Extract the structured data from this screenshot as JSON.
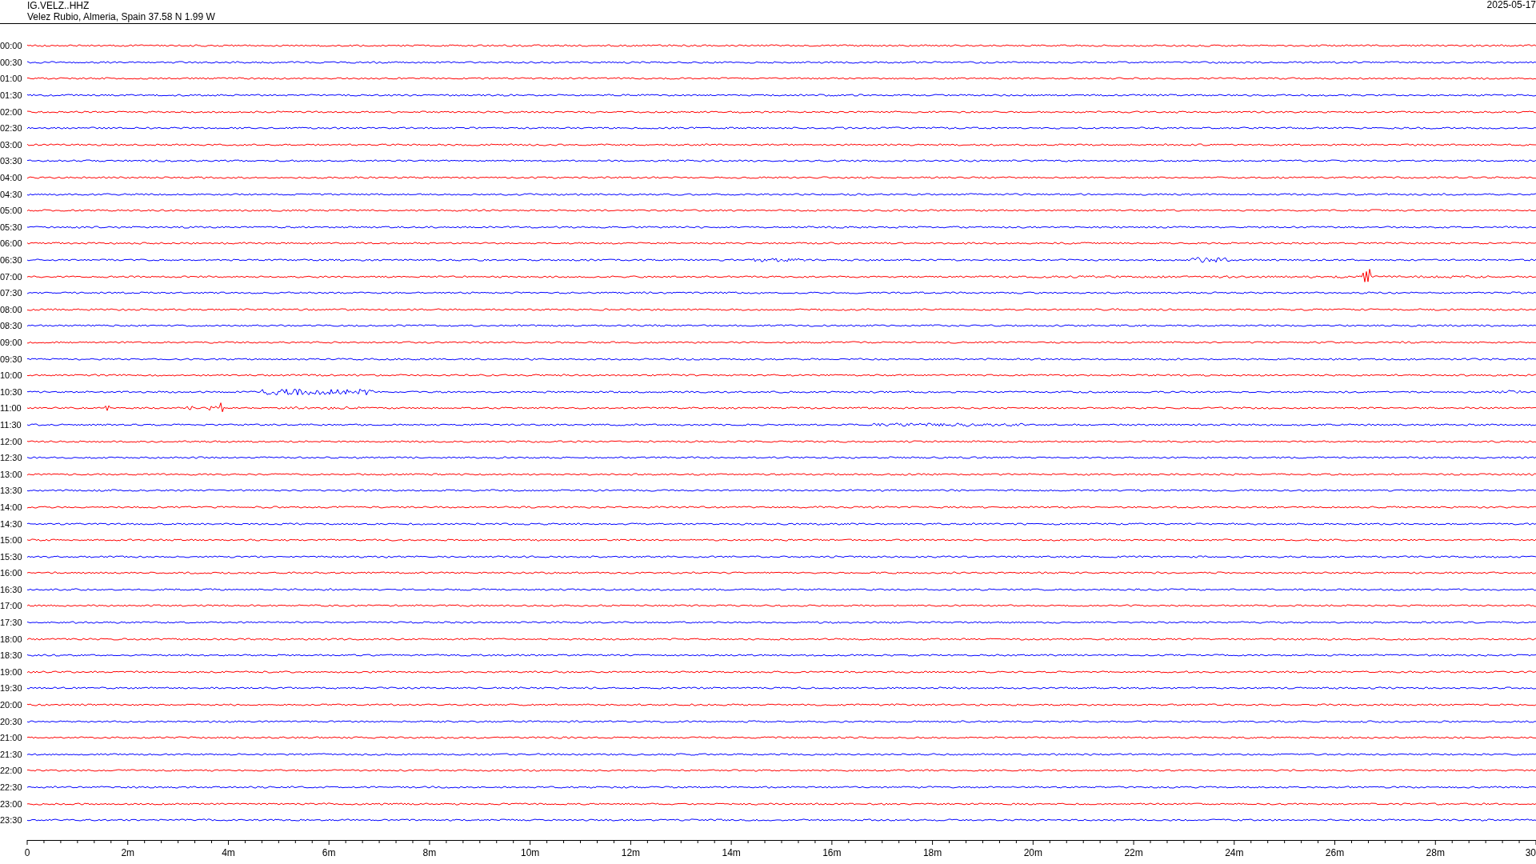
{
  "header": {
    "station": "IG.VELZ..HHZ",
    "location": "Velez Rubio, Almeria, Spain  37.58 N 1.99 W",
    "date": "2025-05-17"
  },
  "rows": [
    {
      "time": "00:00",
      "color": "#ff0000"
    },
    {
      "time": "00:30",
      "color": "#0000ff"
    },
    {
      "time": "01:00",
      "color": "#ff0000"
    },
    {
      "time": "01:30",
      "color": "#0000ff"
    },
    {
      "time": "02:00",
      "color": "#ff0000"
    },
    {
      "time": "02:30",
      "color": "#0000ff"
    },
    {
      "time": "03:00",
      "color": "#ff0000"
    },
    {
      "time": "03:30",
      "color": "#0000ff"
    },
    {
      "time": "04:00",
      "color": "#ff0000"
    },
    {
      "time": "04:30",
      "color": "#0000ff"
    },
    {
      "time": "05:00",
      "color": "#ff0000"
    },
    {
      "time": "05:30",
      "color": "#0000ff"
    },
    {
      "time": "06:00",
      "color": "#ff0000"
    },
    {
      "time": "06:30",
      "color": "#0000ff"
    },
    {
      "time": "07:00",
      "color": "#ff0000"
    },
    {
      "time": "07:30",
      "color": "#0000ff"
    },
    {
      "time": "08:00",
      "color": "#ff0000"
    },
    {
      "time": "08:30",
      "color": "#0000ff"
    },
    {
      "time": "09:00",
      "color": "#ff0000"
    },
    {
      "time": "09:30",
      "color": "#0000ff"
    },
    {
      "time": "10:00",
      "color": "#ff0000"
    },
    {
      "time": "10:30",
      "color": "#0000ff"
    },
    {
      "time": "11:00",
      "color": "#ff0000"
    },
    {
      "time": "11:30",
      "color": "#0000ff"
    },
    {
      "time": "12:00",
      "color": "#ff0000"
    },
    {
      "time": "12:30",
      "color": "#0000ff"
    },
    {
      "time": "13:00",
      "color": "#ff0000"
    },
    {
      "time": "13:30",
      "color": "#0000ff"
    },
    {
      "time": "14:00",
      "color": "#ff0000"
    },
    {
      "time": "14:30",
      "color": "#0000ff"
    },
    {
      "time": "15:00",
      "color": "#ff0000"
    },
    {
      "time": "15:30",
      "color": "#0000ff"
    },
    {
      "time": "16:00",
      "color": "#ff0000"
    },
    {
      "time": "16:30",
      "color": "#0000ff"
    },
    {
      "time": "17:00",
      "color": "#ff0000"
    },
    {
      "time": "17:30",
      "color": "#0000ff"
    },
    {
      "time": "18:00",
      "color": "#ff0000"
    },
    {
      "time": "18:30",
      "color": "#0000ff"
    },
    {
      "time": "19:00",
      "color": "#ff0000"
    },
    {
      "time": "19:30",
      "color": "#0000ff"
    },
    {
      "time": "20:00",
      "color": "#ff0000"
    },
    {
      "time": "20:30",
      "color": "#0000ff"
    },
    {
      "time": "21:00",
      "color": "#ff0000"
    },
    {
      "time": "21:30",
      "color": "#0000ff"
    },
    {
      "time": "22:00",
      "color": "#ff0000"
    },
    {
      "time": "22:30",
      "color": "#0000ff"
    },
    {
      "time": "23:00",
      "color": "#ff0000"
    },
    {
      "time": "23:30",
      "color": "#0000ff"
    }
  ],
  "axis": {
    "ticks": [
      "0",
      "2m",
      "4m",
      "6m",
      "8m",
      "10m",
      "12m",
      "14m",
      "16m",
      "18m",
      "20m",
      "22m",
      "24m",
      "26m",
      "28m",
      "30"
    ]
  }
}
